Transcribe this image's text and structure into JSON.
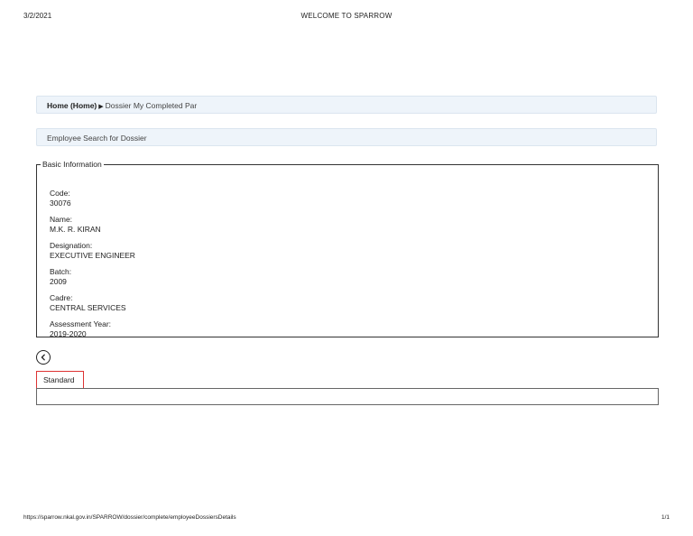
{
  "print_header": {
    "date": "3/2/2021",
    "title": "WELCOME TO SPARROW"
  },
  "breadcrumb": {
    "home": "Home (Home)",
    "arrow": "▶",
    "rest": "Dossier My Completed Par"
  },
  "search_bar": {
    "label": "Employee Search for Dossier"
  },
  "basic_info": {
    "legend": "Basic Information",
    "fields": [
      {
        "label": "Code:",
        "value": "30076"
      },
      {
        "label": "Name:",
        "value": "M.K. R. KIRAN"
      },
      {
        "label": "Designation:",
        "value": "EXECUTIVE ENGINEER"
      },
      {
        "label": "Batch:",
        "value": "2009"
      },
      {
        "label": "Cadre:",
        "value": "CENTRAL SERVICES"
      },
      {
        "label": "Assessment Year:",
        "value": "2019-2020"
      }
    ]
  },
  "back_button": {
    "icon": "chevron-left-icon"
  },
  "tabs": [
    {
      "label": "Standard",
      "active": true,
      "border_color": "#dd3333"
    }
  ],
  "footer": {
    "url": "https://sparrow.nkal.gov.in/SPARROW/dossier/complete/employeeDossiersDetails",
    "page": "1/1"
  }
}
